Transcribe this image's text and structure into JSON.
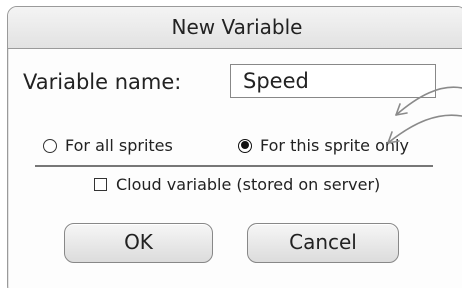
{
  "dialog": {
    "title": "New Variable",
    "name_label": "Variable name:",
    "name_value": "Speed",
    "scope_options": [
      {
        "label": "For all sprites",
        "selected": false
      },
      {
        "label": "For this sprite only",
        "selected": true
      }
    ],
    "cloud_label": "Cloud variable (stored on server)",
    "cloud_checked": false,
    "ok_label": "OK",
    "cancel_label": "Cancel"
  },
  "colors": {
    "border": "#9a9a9a",
    "titlebar": "#e8e8e8",
    "arrow": "#8a8a8a"
  }
}
